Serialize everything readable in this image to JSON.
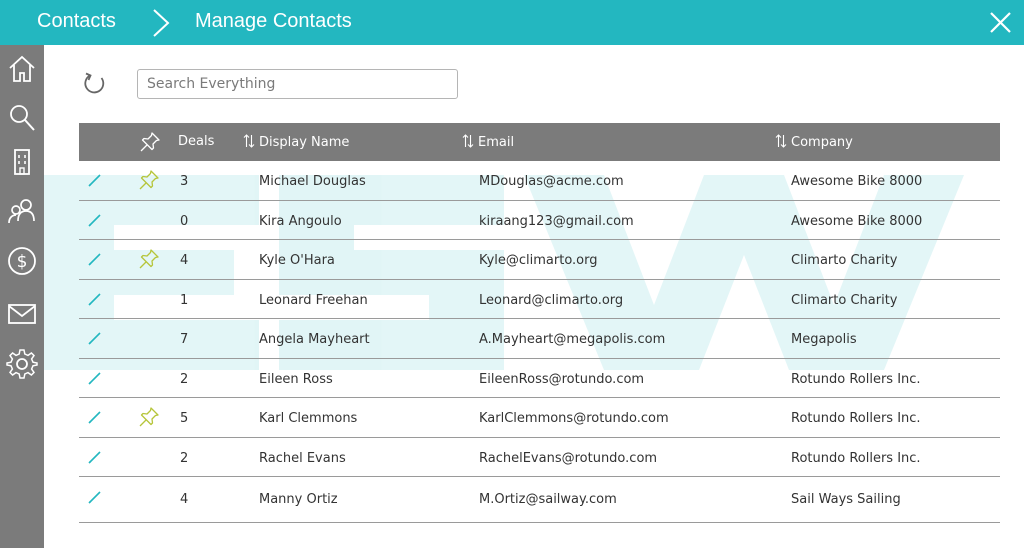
{
  "header": {
    "breadcrumb_root": "Contacts",
    "breadcrumb_current": "Manage Contacts",
    "color": "#23b7c0"
  },
  "sidebar": {
    "items": [
      {
        "icon": "home-icon"
      },
      {
        "icon": "search-icon"
      },
      {
        "icon": "building-icon"
      },
      {
        "icon": "people-icon"
      },
      {
        "icon": "dollar-icon"
      },
      {
        "icon": "mail-icon"
      },
      {
        "icon": "gear-icon"
      }
    ]
  },
  "toolbar": {
    "search_placeholder": "Search Everything"
  },
  "table": {
    "columns": {
      "deals": "Deals",
      "name": "Display Name",
      "email": "Email",
      "company": "Company"
    },
    "rows": [
      {
        "pinned": true,
        "deals": "3",
        "name": "Michael Douglas",
        "email": "MDouglas@acme.com",
        "company": "Awesome Bike 8000"
      },
      {
        "pinned": false,
        "deals": "0",
        "name": "Kira Angoulo",
        "email": "kiraang123@gmail.com",
        "company": "Awesome Bike 8000"
      },
      {
        "pinned": true,
        "deals": "4",
        "name": "Kyle O'Hara",
        "email": "Kyle@climarto.org",
        "company": "Climarto Charity"
      },
      {
        "pinned": false,
        "deals": "1",
        "name": "Leonard Freehan",
        "email": "Leonard@climarto.org",
        "company": "Climarto Charity"
      },
      {
        "pinned": false,
        "deals": "7",
        "name": "Angela Mayheart",
        "email": "A.Mayheart@megapolis.com",
        "company": "Megapolis"
      },
      {
        "pinned": false,
        "deals": "2",
        "name": "Eileen Ross",
        "email": "EileenRoss@rotundo.com",
        "company": "Rotundo Rollers Inc."
      },
      {
        "pinned": true,
        "deals": "5",
        "name": "Karl Clemmons",
        "email": "KarlClemmons@rotundo.com",
        "company": "Rotundo Rollers Inc."
      },
      {
        "pinned": false,
        "deals": "2",
        "name": "Rachel Evans",
        "email": "RachelEvans@rotundo.com",
        "company": "Rotundo Rollers Inc."
      },
      {
        "pinned": false,
        "deals": "4",
        "name": "Manny Ortiz",
        "email": "M.Ortiz@sailway.com",
        "company": "Sail Ways Sailing"
      }
    ]
  },
  "colors": {
    "accent": "#23b7c0",
    "pin_active": "#b6c53a",
    "sidebar": "#7b7b7b",
    "header_row": "#7b7b7b"
  }
}
